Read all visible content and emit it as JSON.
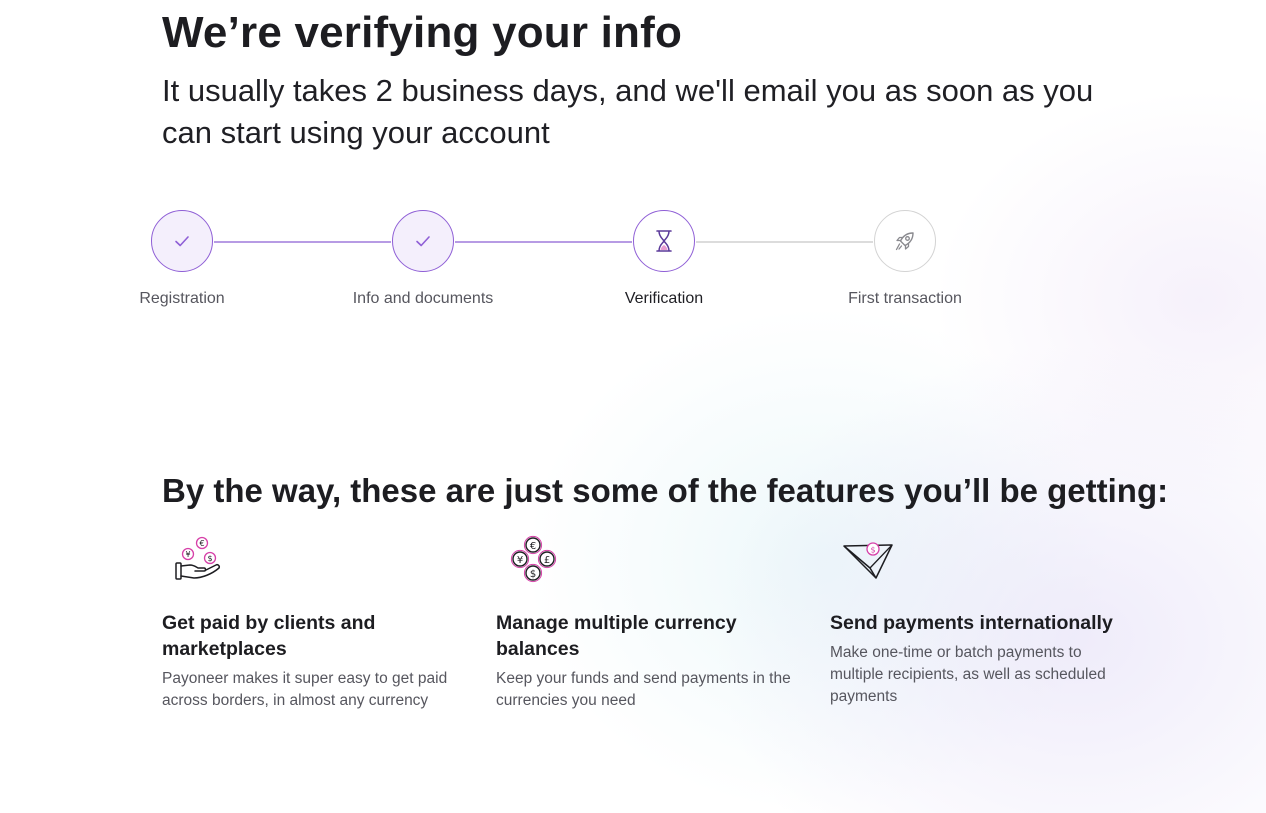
{
  "header": {
    "title": "We’re verifying your info",
    "subtitle": "It usually takes 2 business days, and we'll email you as soon as you can start using your account"
  },
  "stepper": {
    "steps": [
      {
        "label": "Registration",
        "status": "completed",
        "icon": "checkmark-icon"
      },
      {
        "label": "Info and documents",
        "status": "completed",
        "icon": "checkmark-icon"
      },
      {
        "label": "Verification",
        "status": "current",
        "icon": "hourglass-icon"
      },
      {
        "label": "First transaction",
        "status": "pending",
        "icon": "rocket-icon"
      }
    ]
  },
  "features": {
    "heading": "By the way, these are just some of the features you’ll be getting:",
    "items": [
      {
        "icon": "hand-with-coins-icon",
        "title": "Get paid by clients and marketplaces",
        "description": "Payoneer makes it super easy to get paid across borders, in almost any currency"
      },
      {
        "icon": "multi-currency-icon",
        "title": "Manage multiple currency balances",
        "description": "Keep your funds and send payments in the currencies you need"
      },
      {
        "icon": "paper-plane-payment-icon",
        "title": "Send payments internationally",
        "description": "Make one-time or batch payments to multiple recipients, as well as scheduled payments"
      }
    ]
  },
  "colors": {
    "accent": "#8f5fd6",
    "accent_light": "#b79be4",
    "pink": "#d63fa8",
    "text_primary": "#1d1d21",
    "text_secondary": "#56565e"
  }
}
